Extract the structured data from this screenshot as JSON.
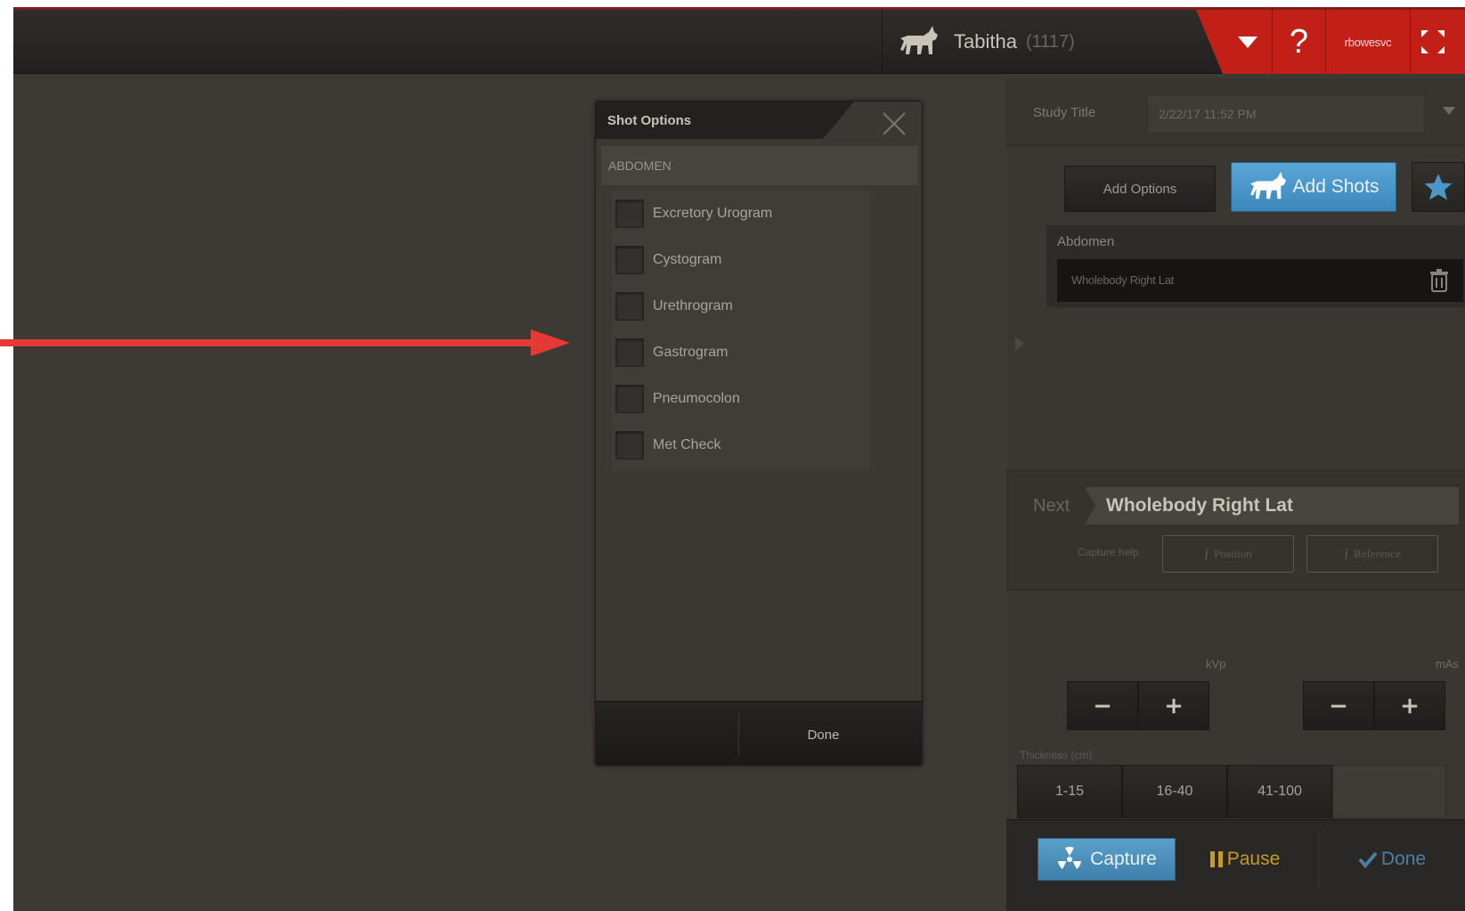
{
  "header": {
    "patient_name": "Tabitha",
    "patient_id": "(1117)",
    "user": "rbowesvc",
    "help_glyph": "?",
    "icons": {
      "patient": "cat-icon",
      "menu": "caret-down-icon",
      "help": "question-icon",
      "fullscreen": "fullscreen-icon"
    }
  },
  "dialog": {
    "title": "Shot Options",
    "section": "ABDOMEN",
    "options": [
      {
        "label": "Excretory Urogram",
        "checked": false
      },
      {
        "label": "Cystogram",
        "checked": false
      },
      {
        "label": "Urethrogram",
        "checked": false
      },
      {
        "label": "Gastrogram",
        "checked": false
      },
      {
        "label": "Pneumocolon",
        "checked": false
      },
      {
        "label": "Met Check",
        "checked": false
      }
    ],
    "done_label": "Done"
  },
  "study": {
    "label": "Study Title",
    "value": "2/22/17 11:52 PM"
  },
  "buttons": {
    "add_options": "Add Options",
    "add_shots": "Add Shots"
  },
  "group": {
    "label": "Abdomen",
    "shot": "Wholebody Right Lat"
  },
  "next": {
    "label": "Next",
    "title": "Wholebody Right Lat",
    "capture_help": "Capture help",
    "position": "Position",
    "reference": "Reference"
  },
  "params": {
    "kvp_label": "kVp",
    "mas_label": "mAs",
    "minus": "−",
    "plus": "+",
    "thickness_label": "Thickness (cm)",
    "thickness_options": [
      "1-15",
      "16-40",
      "41-100"
    ]
  },
  "actions": {
    "capture": "Capture",
    "pause": "Pause",
    "done": "Done"
  },
  "colors": {
    "accent_red": "#c21f17",
    "accent_blue": "#4a95c9",
    "pause_yellow": "#c99a22",
    "annotation_arrow": "#e53935"
  }
}
